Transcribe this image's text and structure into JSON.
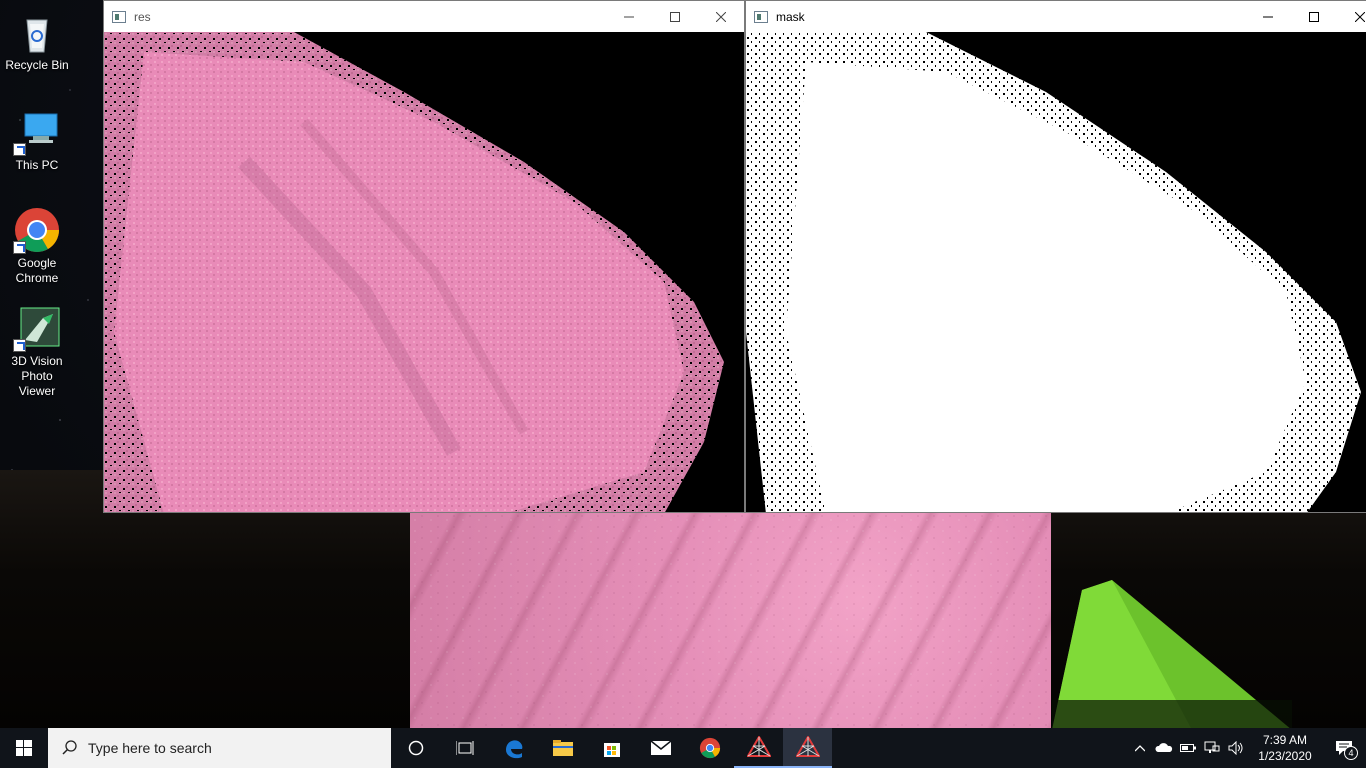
{
  "desktop": {
    "icons": [
      {
        "label": "Recycle Bin",
        "icon": "recycle-bin-icon"
      },
      {
        "label": "This PC",
        "icon": "computer-icon"
      },
      {
        "label": "Google Chrome",
        "icon": "chrome-icon"
      },
      {
        "label": "3D Vision Photo Viewer",
        "icon": "3d-vision-icon"
      }
    ]
  },
  "windows": {
    "res": {
      "title": "res"
    },
    "mask": {
      "title": "mask"
    }
  },
  "taskbar": {
    "search_placeholder": "Type here to search",
    "pinned": [
      "cortana-icon",
      "task-view-icon",
      "edge-icon",
      "file-explorer-icon",
      "store-icon",
      "mail-icon",
      "chrome-icon",
      "opencv-app-icon",
      "opencv-app-active-icon"
    ]
  },
  "tray": {
    "time": "7:39 AM",
    "date": "1/23/2020",
    "notification_count": "4"
  },
  "colors": {
    "pink": "#ee8fbf",
    "taskbar": "#10141a",
    "tent_green": "#7fd33a"
  }
}
